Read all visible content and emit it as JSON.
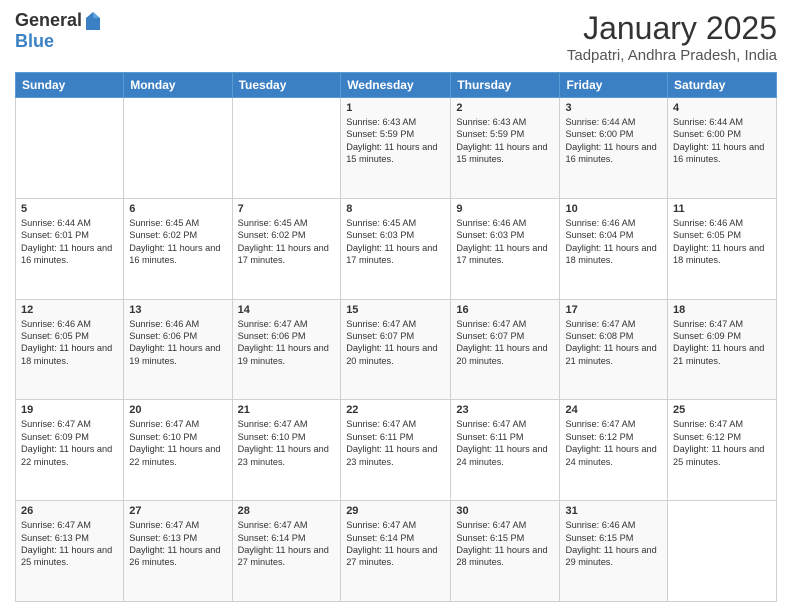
{
  "logo": {
    "general": "General",
    "blue": "Blue"
  },
  "header": {
    "month_title": "January 2025",
    "location": "Tadpatri, Andhra Pradesh, India"
  },
  "days_of_week": [
    "Sunday",
    "Monday",
    "Tuesday",
    "Wednesday",
    "Thursday",
    "Friday",
    "Saturday"
  ],
  "weeks": [
    [
      {
        "day": "",
        "info": ""
      },
      {
        "day": "",
        "info": ""
      },
      {
        "day": "",
        "info": ""
      },
      {
        "day": "1",
        "info": "Sunrise: 6:43 AM\nSunset: 5:59 PM\nDaylight: 11 hours and 15 minutes."
      },
      {
        "day": "2",
        "info": "Sunrise: 6:43 AM\nSunset: 5:59 PM\nDaylight: 11 hours and 15 minutes."
      },
      {
        "day": "3",
        "info": "Sunrise: 6:44 AM\nSunset: 6:00 PM\nDaylight: 11 hours and 16 minutes."
      },
      {
        "day": "4",
        "info": "Sunrise: 6:44 AM\nSunset: 6:00 PM\nDaylight: 11 hours and 16 minutes."
      }
    ],
    [
      {
        "day": "5",
        "info": "Sunrise: 6:44 AM\nSunset: 6:01 PM\nDaylight: 11 hours and 16 minutes."
      },
      {
        "day": "6",
        "info": "Sunrise: 6:45 AM\nSunset: 6:02 PM\nDaylight: 11 hours and 16 minutes."
      },
      {
        "day": "7",
        "info": "Sunrise: 6:45 AM\nSunset: 6:02 PM\nDaylight: 11 hours and 17 minutes."
      },
      {
        "day": "8",
        "info": "Sunrise: 6:45 AM\nSunset: 6:03 PM\nDaylight: 11 hours and 17 minutes."
      },
      {
        "day": "9",
        "info": "Sunrise: 6:46 AM\nSunset: 6:03 PM\nDaylight: 11 hours and 17 minutes."
      },
      {
        "day": "10",
        "info": "Sunrise: 6:46 AM\nSunset: 6:04 PM\nDaylight: 11 hours and 18 minutes."
      },
      {
        "day": "11",
        "info": "Sunrise: 6:46 AM\nSunset: 6:05 PM\nDaylight: 11 hours and 18 minutes."
      }
    ],
    [
      {
        "day": "12",
        "info": "Sunrise: 6:46 AM\nSunset: 6:05 PM\nDaylight: 11 hours and 18 minutes."
      },
      {
        "day": "13",
        "info": "Sunrise: 6:46 AM\nSunset: 6:06 PM\nDaylight: 11 hours and 19 minutes."
      },
      {
        "day": "14",
        "info": "Sunrise: 6:47 AM\nSunset: 6:06 PM\nDaylight: 11 hours and 19 minutes."
      },
      {
        "day": "15",
        "info": "Sunrise: 6:47 AM\nSunset: 6:07 PM\nDaylight: 11 hours and 20 minutes."
      },
      {
        "day": "16",
        "info": "Sunrise: 6:47 AM\nSunset: 6:07 PM\nDaylight: 11 hours and 20 minutes."
      },
      {
        "day": "17",
        "info": "Sunrise: 6:47 AM\nSunset: 6:08 PM\nDaylight: 11 hours and 21 minutes."
      },
      {
        "day": "18",
        "info": "Sunrise: 6:47 AM\nSunset: 6:09 PM\nDaylight: 11 hours and 21 minutes."
      }
    ],
    [
      {
        "day": "19",
        "info": "Sunrise: 6:47 AM\nSunset: 6:09 PM\nDaylight: 11 hours and 22 minutes."
      },
      {
        "day": "20",
        "info": "Sunrise: 6:47 AM\nSunset: 6:10 PM\nDaylight: 11 hours and 22 minutes."
      },
      {
        "day": "21",
        "info": "Sunrise: 6:47 AM\nSunset: 6:10 PM\nDaylight: 11 hours and 23 minutes."
      },
      {
        "day": "22",
        "info": "Sunrise: 6:47 AM\nSunset: 6:11 PM\nDaylight: 11 hours and 23 minutes."
      },
      {
        "day": "23",
        "info": "Sunrise: 6:47 AM\nSunset: 6:11 PM\nDaylight: 11 hours and 24 minutes."
      },
      {
        "day": "24",
        "info": "Sunrise: 6:47 AM\nSunset: 6:12 PM\nDaylight: 11 hours and 24 minutes."
      },
      {
        "day": "25",
        "info": "Sunrise: 6:47 AM\nSunset: 6:12 PM\nDaylight: 11 hours and 25 minutes."
      }
    ],
    [
      {
        "day": "26",
        "info": "Sunrise: 6:47 AM\nSunset: 6:13 PM\nDaylight: 11 hours and 25 minutes."
      },
      {
        "day": "27",
        "info": "Sunrise: 6:47 AM\nSunset: 6:13 PM\nDaylight: 11 hours and 26 minutes."
      },
      {
        "day": "28",
        "info": "Sunrise: 6:47 AM\nSunset: 6:14 PM\nDaylight: 11 hours and 27 minutes."
      },
      {
        "day": "29",
        "info": "Sunrise: 6:47 AM\nSunset: 6:14 PM\nDaylight: 11 hours and 27 minutes."
      },
      {
        "day": "30",
        "info": "Sunrise: 6:47 AM\nSunset: 6:15 PM\nDaylight: 11 hours and 28 minutes."
      },
      {
        "day": "31",
        "info": "Sunrise: 6:46 AM\nSunset: 6:15 PM\nDaylight: 11 hours and 29 minutes."
      },
      {
        "day": "",
        "info": ""
      }
    ]
  ]
}
